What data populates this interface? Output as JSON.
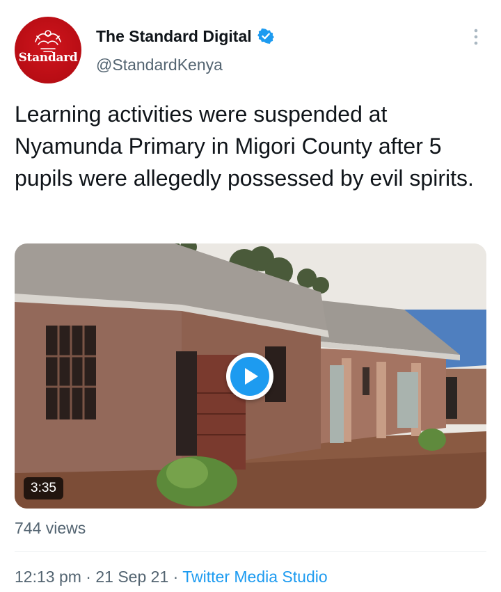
{
  "account": {
    "display_name": "The Standard Digital",
    "handle": "@StandardKenya",
    "avatar_logo_text": "Standard",
    "verified": true
  },
  "tweet": {
    "text": "Learning activities were suspended at Nyamunda Primary in Migori County after 5 pupils were allegedly possessed by evil spirits."
  },
  "media": {
    "type": "video",
    "duration": "3:35",
    "views": "744 views"
  },
  "meta": {
    "time": "12:13 pm",
    "separator": " · ",
    "date": "21 Sep 21",
    "source": "Twitter Media Studio"
  },
  "colors": {
    "accent": "#1d9bf0",
    "secondary_text": "#536471",
    "avatar_red": "#c8111a"
  },
  "icons": {
    "verified": "verified-badge-icon",
    "more": "more-options-icon",
    "play": "play-icon"
  }
}
